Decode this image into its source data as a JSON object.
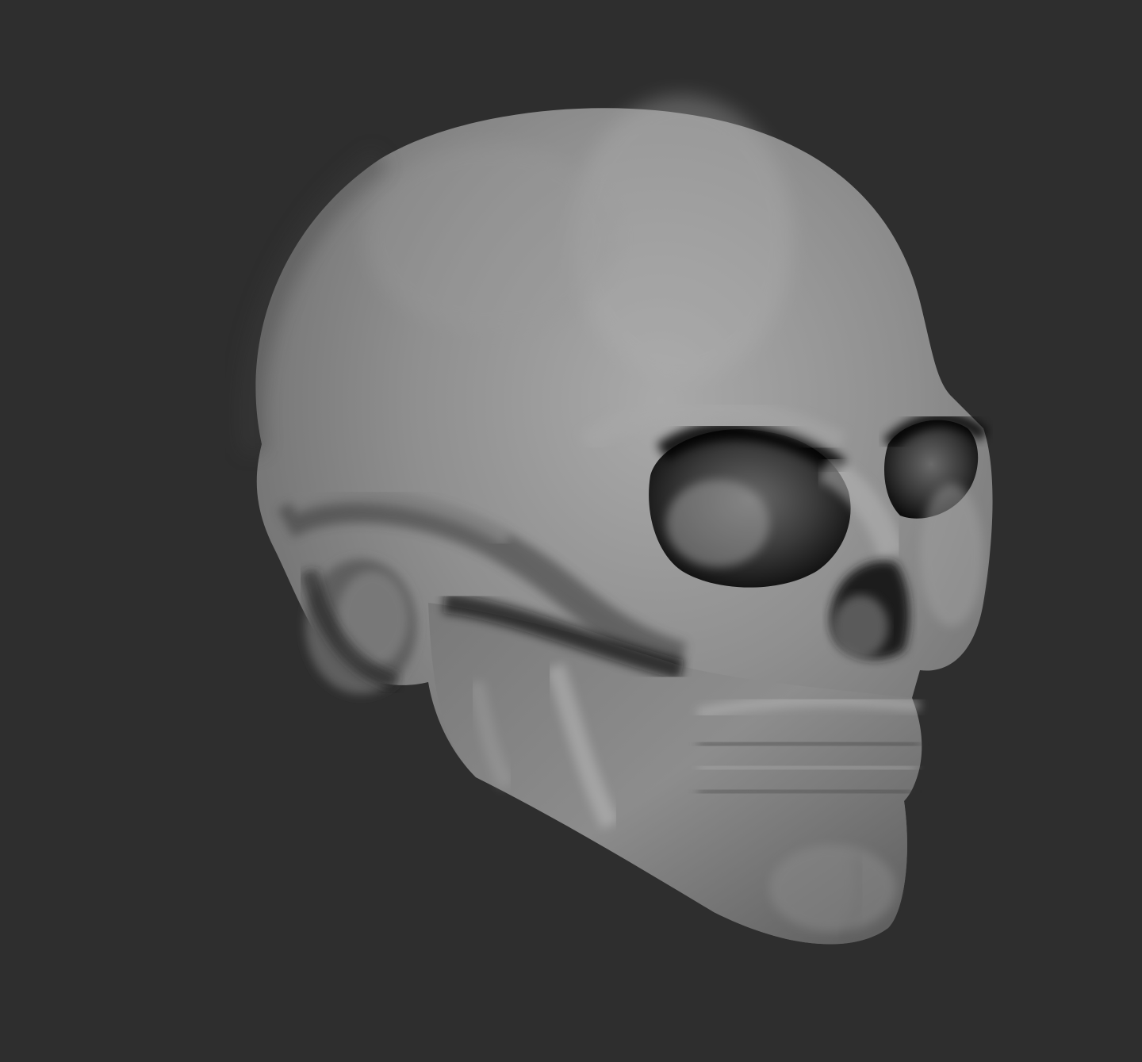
{
  "viewport": {
    "background_color": "#2e2e2e",
    "model": {
      "subject": "skull-sculpt",
      "material_color": "#8a8a8a",
      "highlight_color": "#b4b4b4",
      "shadow_color": "#141414"
    }
  }
}
